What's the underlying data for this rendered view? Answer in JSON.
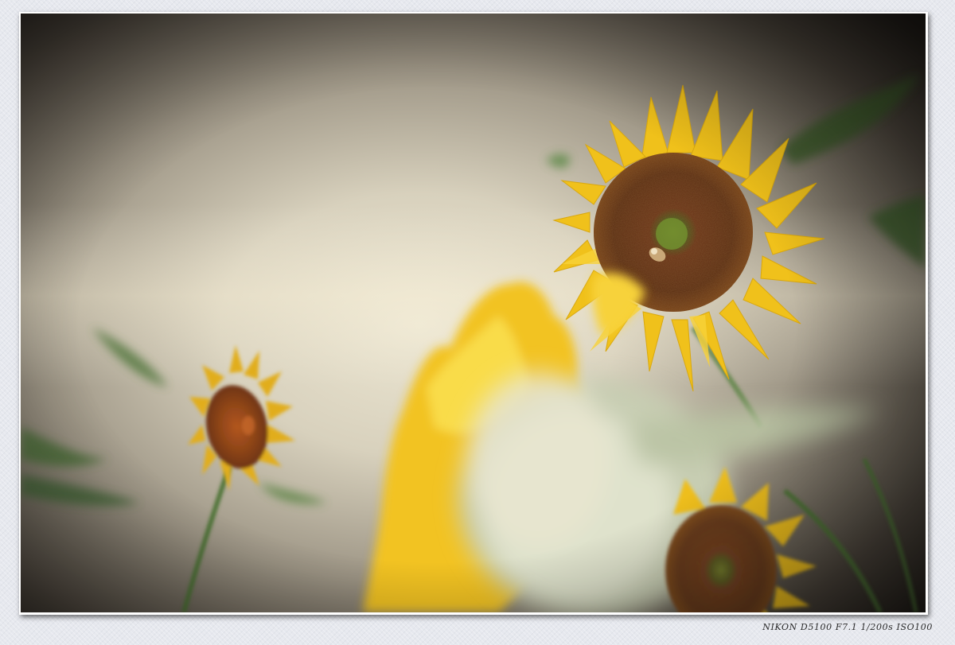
{
  "caption": {
    "exif_text": "NIKON D5100 F7.1 1/200s ISO100"
  },
  "photo": {
    "subject": "sunflowers",
    "palette": {
      "background_light": "#ece6d2",
      "background_dark": "#1a1612",
      "petal_yellow": "#f3c51c",
      "petal_glow": "#fff06a",
      "disk_brown": "#5a2d12",
      "leaf_green": "#4c7a3c",
      "frame_border": "#ffffff",
      "page_background": "#e6e8ee"
    }
  }
}
